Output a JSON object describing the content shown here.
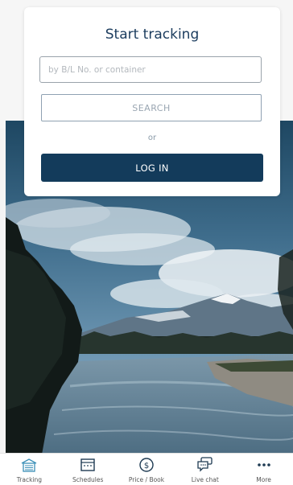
{
  "card": {
    "title": "Start tracking",
    "search_placeholder": "by B/L No. or container",
    "search_label": "SEARCH",
    "or_text": "or",
    "login_label": "LOG IN"
  },
  "tabbar": {
    "items": [
      {
        "label": "Tracking",
        "icon": "warehouse-icon",
        "active": true
      },
      {
        "label": "Schedules",
        "icon": "calendar-icon",
        "active": false
      },
      {
        "label": "Price / Book",
        "icon": "dollar-coin-icon",
        "active": false
      },
      {
        "label": "Live chat",
        "icon": "chat-bubble-icon",
        "active": false
      },
      {
        "label": "More",
        "icon": "more-dots-icon",
        "active": false
      }
    ]
  },
  "colors": {
    "brand_navy": "#133b5b",
    "title_text": "#1a3b5d",
    "tracking_icon": "#3a8fb7"
  }
}
